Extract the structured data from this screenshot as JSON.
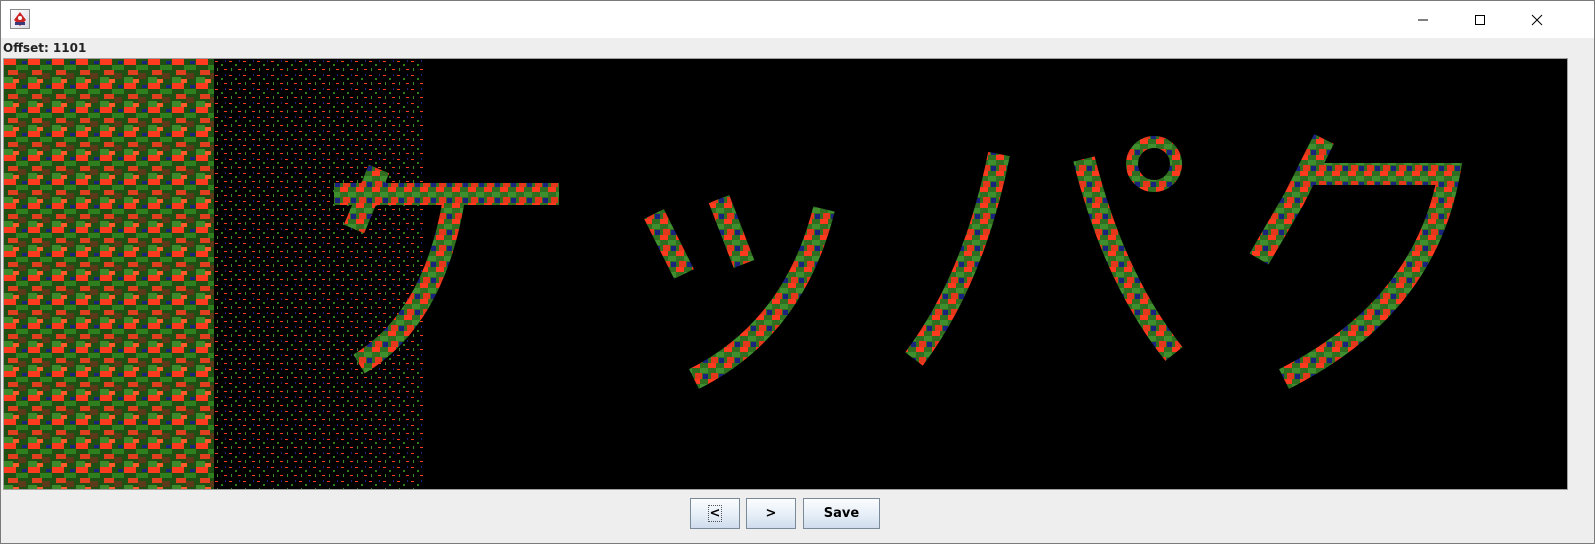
{
  "window": {
    "title": "",
    "controls": {
      "minimize": "minimize-icon",
      "maximize": "maximize-icon",
      "close": "close-icon"
    }
  },
  "status": {
    "offset_text": "Offset: 1101"
  },
  "viewport": {
    "description_icon": "rendered-image",
    "background_color": "#000000",
    "accent_colors": [
      "#ff3b1f",
      "#2f7f1f",
      "#1a237e"
    ]
  },
  "buttons": {
    "prev_label": "<",
    "next_label": ">",
    "save_label": "Save"
  }
}
